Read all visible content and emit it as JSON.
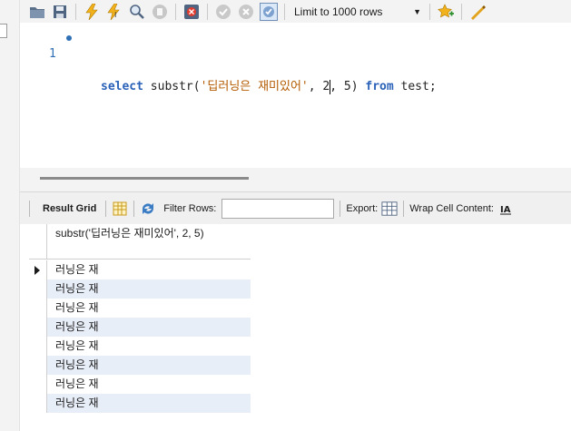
{
  "toolbar": {
    "limit_label": "Limit to 1000 rows",
    "icons": [
      "folder-icon",
      "save-icon",
      "execute-icon",
      "execute-current-icon",
      "explain-icon",
      "stop-icon",
      "toggle-error-icon",
      "commit-icon",
      "rollback-icon",
      "autocommit-icon",
      "bookmark-icon",
      "beautify-icon"
    ]
  },
  "editor": {
    "line_number": "1",
    "tokens": {
      "kw_select": "select",
      "fn": " substr(",
      "string": "'딥러닝은 재미있어'",
      "sep1": ", ",
      "num1a": "2",
      "num1b": ", 5) ",
      "kw_from": "from",
      "rest": " test;"
    }
  },
  "result_bar": {
    "result_grid_label": "Result Grid",
    "filter_label": "Filter Rows:",
    "filter_value": "",
    "export_label": "Export:",
    "wrap_label": "Wrap Cell Content:"
  },
  "grid": {
    "column_header": "substr('딥러닝은 재미있어', 2, 5)",
    "rows": [
      "러닝은 재",
      "러닝은 재",
      "러닝은 재",
      "러닝은 재",
      "러닝은 재",
      "러닝은 재",
      "러닝은 재",
      "러닝은 재"
    ]
  }
}
